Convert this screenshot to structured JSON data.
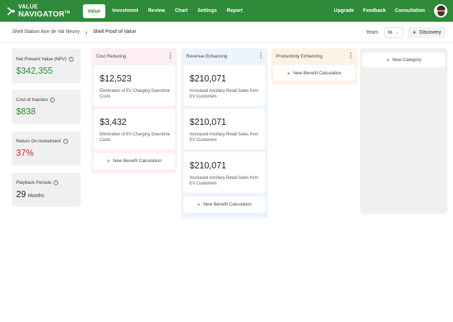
{
  "brand": {
    "line1": "VALUE",
    "line2": "NAVIGATOR",
    "tm": "TM"
  },
  "nav": {
    "items": [
      "Value",
      "Investment",
      "Review",
      "Chart",
      "Settings",
      "Report"
    ],
    "active": "Value",
    "right": [
      "Upgrade",
      "Feedback",
      "Consultation"
    ]
  },
  "breadcrumb": {
    "first": "Shell Station Aire de Val Neuvy",
    "last": "Shell Proof of Value"
  },
  "controls": {
    "years_label": "Years",
    "years_value": "06",
    "discovery_label": "Discovery"
  },
  "metrics": [
    {
      "label": "Net Present Value (NPV)",
      "value": "$342,355",
      "tone": "green"
    },
    {
      "label": "Cost of Inaction",
      "value": "$838",
      "tone": "green"
    },
    {
      "label": "Return On Investment",
      "value": "37%",
      "tone": "red"
    },
    {
      "label": "Playback Periods",
      "value": "29",
      "unit": "Months",
      "tone": "dark"
    }
  ],
  "columns": [
    {
      "title": "Cost Reducing",
      "cards": [
        {
          "amount": "$12,523",
          "desc": "Elimination of EV Charging Downtime Costs"
        },
        {
          "amount": "$3,432",
          "desc": "Elimination of EV Charging Downtime Costs"
        }
      ],
      "add_label": "New Benefit Calculation"
    },
    {
      "title": "Revenue Enhancing",
      "cards": [
        {
          "amount": "$210,071",
          "desc": "Increased Ancillary Retail Sales from EV Customers"
        },
        {
          "amount": "$210,071",
          "desc": "Increased Ancillary Retail Sales from EV Customers"
        },
        {
          "amount": "$210,071",
          "desc": "Increased Ancillary Retail Sales from EV Customers"
        }
      ],
      "add_label": "New Benefit Calculation"
    },
    {
      "title": "Productivity Enhancing",
      "cards": [],
      "add_label": "New Benefit Calculation"
    },
    {
      "title": "",
      "cards": [],
      "add_label": "New Category"
    }
  ],
  "colors": {
    "brand_green": "#2f8a3a",
    "cost_reducing_bg": "#fdeef1",
    "revenue_enhancing_bg": "#ecf3fc",
    "productivity_enhancing_bg": "#fdf2e6",
    "new_category_bg": "#f0f0f0",
    "roi_red": "#e0241d"
  }
}
